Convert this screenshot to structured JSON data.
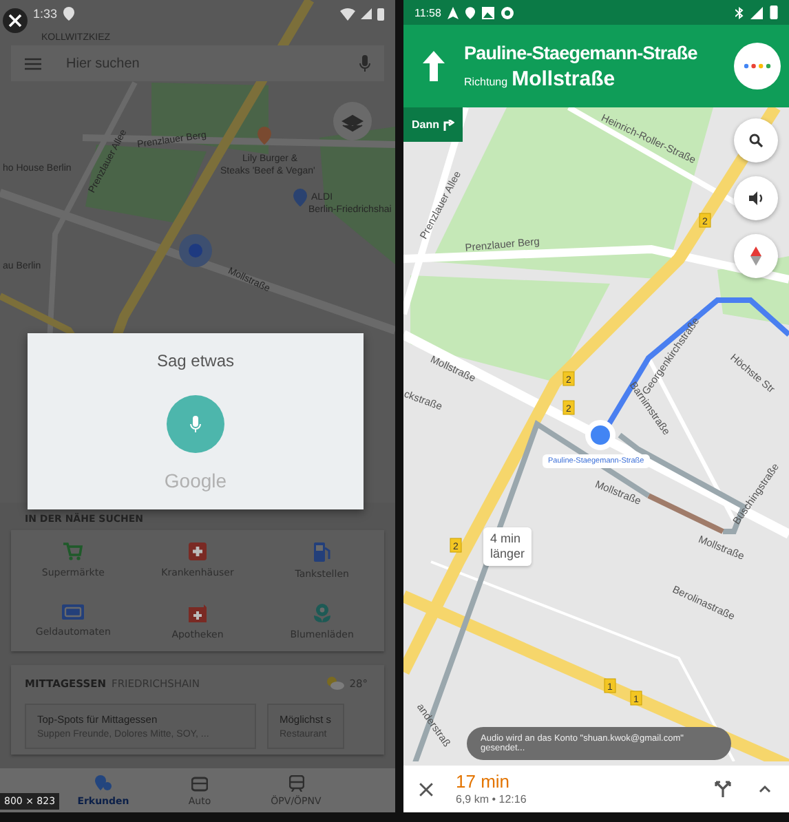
{
  "left_screen": {
    "status_bar": {
      "time": "1:33"
    },
    "search": {
      "placeholder": "Hier suchen"
    },
    "map_labels": [
      {
        "text": "KOLLWITZKIEZ"
      },
      {
        "text": "Prenzlauer Berg"
      },
      {
        "text": "Prenzlauer Allee"
      },
      {
        "text": "ho House Berlin"
      },
      {
        "text": "Lily Burger &"
      },
      {
        "text": "Steaks 'Beef & Vegan'"
      },
      {
        "text": "ALDI"
      },
      {
        "text": "Berlin-Friedrichshai"
      },
      {
        "text": "au Berlin"
      },
      {
        "text": "Mollstraße"
      }
    ],
    "voice_dialog": {
      "title": "Sag etwas",
      "brand": "Google"
    },
    "nearby": {
      "heading": "IN DER NÄHE SUCHEN",
      "items": [
        {
          "label": "Supermärkte",
          "kind": "cart"
        },
        {
          "label": "Krankenhäuser",
          "kind": "hospital"
        },
        {
          "label": "Tankstellen",
          "kind": "fuel"
        },
        {
          "label": "Geldautomaten",
          "kind": "atm"
        },
        {
          "label": "Apotheken",
          "kind": "pharmacy"
        },
        {
          "label": "Blumenläden",
          "kind": "flower"
        }
      ]
    },
    "lunch": {
      "heading": "MITTAGESSEN",
      "area": "FRIEDRICHSHAIN",
      "temperature": "28°",
      "cards": [
        {
          "title": "Top-Spots für Mittagessen",
          "subtitle": "Suppen Freunde, Dolores Mitte, SOY, ..."
        },
        {
          "title": "Möglichst s",
          "subtitle": "Restaurant"
        }
      ]
    },
    "bottom_nav": [
      {
        "label": "Erkunden",
        "kind": "explore",
        "selected": true
      },
      {
        "label": "Auto",
        "kind": "car",
        "selected": false
      },
      {
        "label": "ÖPV/ÖPNV",
        "kind": "transit",
        "selected": false
      }
    ],
    "image_size": "800 × 823"
  },
  "right_screen": {
    "status_bar": {
      "time": "11:58"
    },
    "navigation": {
      "street": "Pauline-Staegemann-Straße",
      "direction_prefix": "Richtung",
      "direction": "Mollstraße",
      "then": "Dann"
    },
    "map_labels": [
      {
        "text": "Heinrich-Roller-Straße"
      },
      {
        "text": "Prenzlauer Allee"
      },
      {
        "text": "Prenzlauer Berg"
      },
      {
        "text": "Mollstraße"
      },
      {
        "text": "ckstraße"
      },
      {
        "text": "Barnimstraße"
      },
      {
        "text": "Georgenkirchstraße"
      },
      {
        "text": "Höchste Str"
      },
      {
        "text": "Mollstraße"
      },
      {
        "text": "Büschingstraße"
      },
      {
        "text": "Mollstraße"
      },
      {
        "text": "Berolinastraße"
      },
      {
        "text": "anderstraß"
      }
    ],
    "route_shields": [
      "2",
      "2",
      "2",
      "2",
      "1",
      "1"
    ],
    "location_label": "Pauline-Staegemann-Straße",
    "alternative": {
      "line_1": "4 min",
      "line_2": "länger"
    },
    "toast": "Audio wird an das Konto \"shuan.kwok@gmail.com\" gesendet...",
    "trip": {
      "duration": "17 min",
      "distance": "6,9 km • 12:16"
    }
  }
}
